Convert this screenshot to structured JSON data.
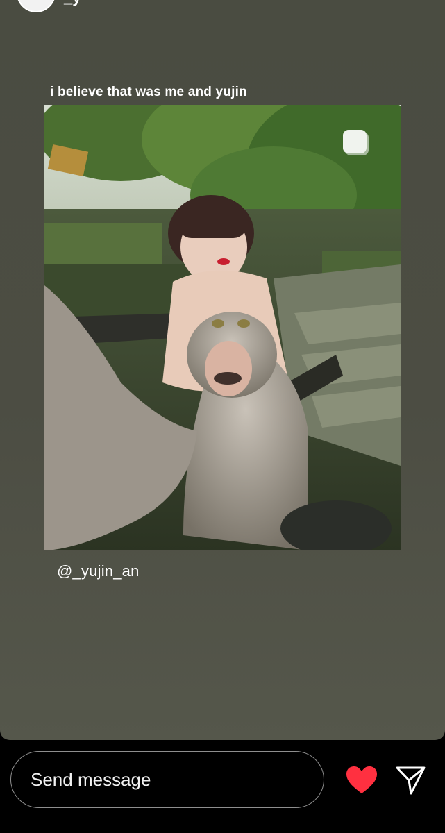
{
  "story": {
    "caption": "i believe that was me and yujin",
    "mention": "@_yujin_an",
    "username_fragment": "_y",
    "photo_icon": "selection-box-icon",
    "photo_description_icon": "photo-icon"
  },
  "footer": {
    "message_placeholder": "Send message",
    "like_icon": "heart-icon",
    "share_icon": "send-icon",
    "like_color": "#ff3040"
  },
  "colors": {
    "story_background": "#4c4d43",
    "bar_background": "#000000"
  }
}
